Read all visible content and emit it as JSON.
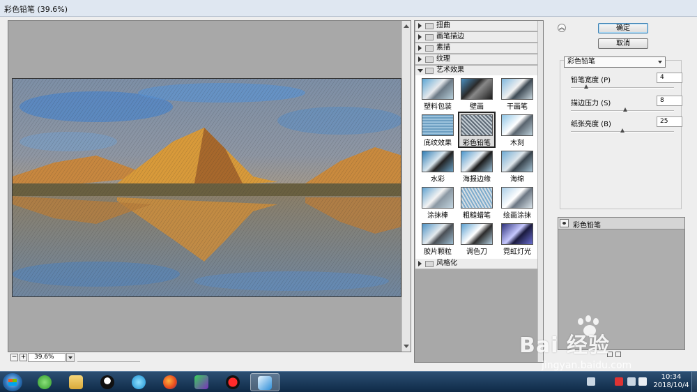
{
  "window": {
    "title": "彩色铅笔 (39.6%)"
  },
  "preview": {
    "zoom_minus": "−",
    "zoom_plus": "+",
    "zoom_value": "39.6%"
  },
  "gallery": {
    "categories": [
      {
        "label": "扭曲",
        "expanded": false
      },
      {
        "label": "画笔描边",
        "expanded": false
      },
      {
        "label": "素描",
        "expanded": false
      },
      {
        "label": "纹理",
        "expanded": false
      },
      {
        "label": "艺术效果",
        "expanded": true
      },
      {
        "label": "风格化",
        "expanded": false
      }
    ],
    "filters": [
      {
        "label": "塑料包装",
        "selected": false
      },
      {
        "label": "壁画",
        "selected": false
      },
      {
        "label": "干画笔",
        "selected": false
      },
      {
        "label": "底纹效果",
        "selected": false
      },
      {
        "label": "彩色铅笔",
        "selected": true
      },
      {
        "label": "木刻",
        "selected": false
      },
      {
        "label": "水彩",
        "selected": false
      },
      {
        "label": "海报边缘",
        "selected": false
      },
      {
        "label": "海绵",
        "selected": false
      },
      {
        "label": "涂抹棒",
        "selected": false
      },
      {
        "label": "粗糙蜡笔",
        "selected": false
      },
      {
        "label": "绘画涂抹",
        "selected": false
      },
      {
        "label": "胶片颗粒",
        "selected": false
      },
      {
        "label": "调色刀",
        "selected": false
      },
      {
        "label": "霓虹灯光",
        "selected": false
      }
    ]
  },
  "controls": {
    "ok_label": "确定",
    "cancel_label": "取消",
    "collapse_icon": "double-chevron-up-icon",
    "filter_select": "彩色铅笔",
    "params": [
      {
        "label": "铅笔宽度 (P)",
        "value": "4",
        "fraction": 0.15
      },
      {
        "label": "描边压力 (S)",
        "value": "8",
        "fraction": 0.53
      },
      {
        "label": "纸张亮度 (B)",
        "value": "25",
        "fraction": 0.5
      }
    ]
  },
  "layers": {
    "items": [
      {
        "name": "彩色铅笔",
        "visible": true
      }
    ]
  },
  "watermark": {
    "text": "Bai 经验",
    "url": "jingyan.baidu.com"
  },
  "taskbar": {
    "apps": [
      "start-orb",
      "green-app",
      "file-explorer",
      "qq",
      "video-player",
      "firefox",
      "media-app",
      "record-app",
      "photoshop-app"
    ],
    "clock_time": "10:34",
    "clock_date": "2018/10/4"
  },
  "colors": {
    "preview_bg": "#a8a8a8",
    "dialog_bg": "#eeeeee",
    "taskbar": "#1c3a5b",
    "ok_border": "#3c7fb1"
  }
}
